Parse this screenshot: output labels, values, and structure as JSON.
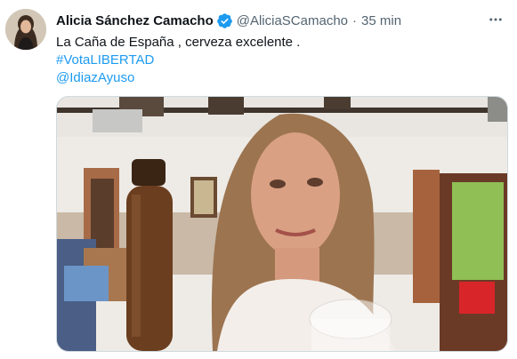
{
  "tweet": {
    "author_name": "Alicia Sánchez Camacho",
    "handle": "@AliciaSCamacho",
    "separator": "·",
    "time": "35 min",
    "text": "La Caña de España , cerveza excelente .",
    "hashtag": "#VotaLIBERTAD",
    "mention": "@IdiazAyuso"
  },
  "icons": {
    "verified": "verified-badge-icon",
    "more": "more-options-icon"
  },
  "colors": {
    "link": "#1d9bf0",
    "verified": "#1d9bf0",
    "secondary_text": "#536471",
    "primary_text": "#0f1419"
  }
}
